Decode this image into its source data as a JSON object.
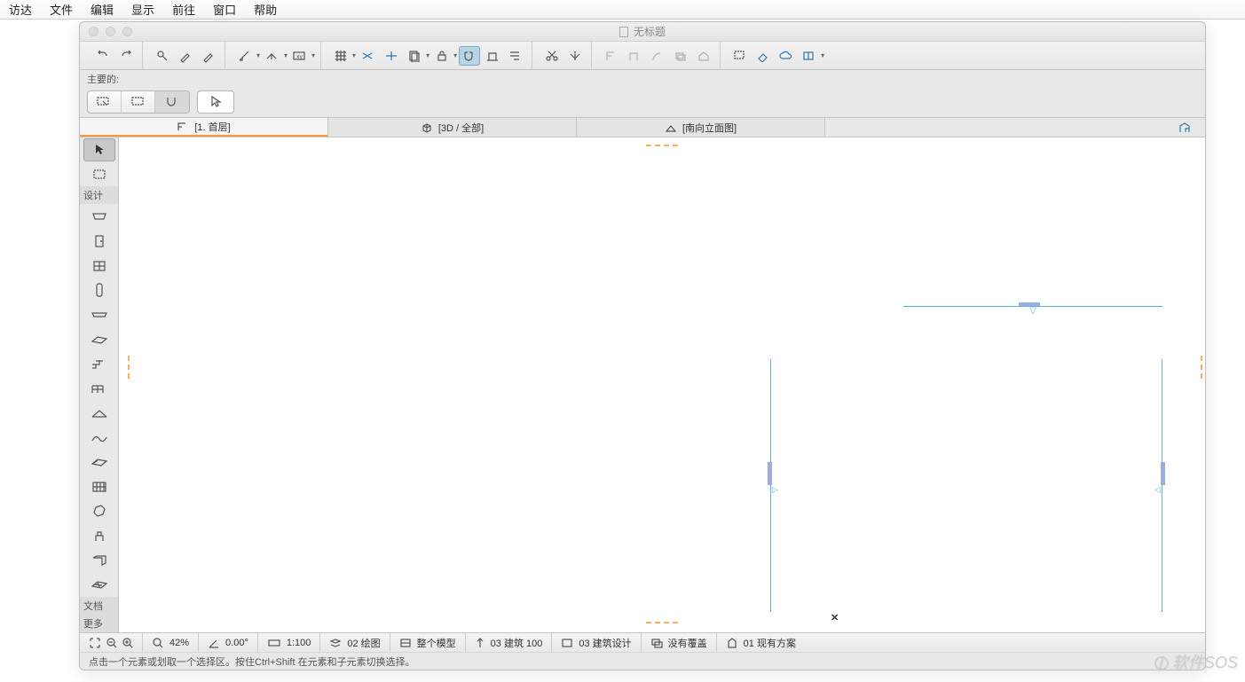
{
  "menubar": {
    "items": [
      "访达",
      "文件",
      "编辑",
      "显示",
      "前往",
      "窗口",
      "帮助"
    ]
  },
  "window": {
    "title": "无标题"
  },
  "proprow": {
    "label": "主要的:"
  },
  "tabs": [
    {
      "label": "[1. 首层]"
    },
    {
      "label": "[3D / 全部]"
    },
    {
      "label": "[南向立面图]"
    }
  ],
  "palette": {
    "head_design": "设计",
    "head_doc": "文档",
    "head_more": "更多"
  },
  "status": {
    "zoom": "42%",
    "angle": "0.00°",
    "scale": "1:100",
    "layer": "02 绘图",
    "model": "整个模型",
    "arch": "03 建筑 100",
    "design": "03 建筑设计",
    "override": "没有覆盖",
    "plan": "01 现有方案"
  },
  "hint": "点击一个元素或划取一个选择区。按住Ctrl+Shift 在元素和子元素切换选择。",
  "watermark": "软件SOS"
}
